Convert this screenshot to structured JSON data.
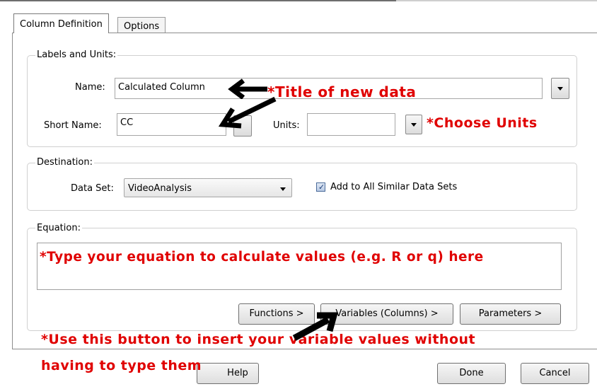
{
  "tabs": [
    {
      "label": "Column Definition",
      "active": true
    },
    {
      "label": "Options",
      "active": false
    }
  ],
  "labels_units": {
    "title": "Labels and Units:",
    "name_label": "Name:",
    "name_value": "Calculated Column",
    "short_name_label": "Short Name:",
    "short_name_value": "CC",
    "units_label": "Units:",
    "units_value": ""
  },
  "destination": {
    "title": "Destination:",
    "data_set_label": "Data Set:",
    "data_set_value": "VideoAnalysis",
    "add_all_label": "Add to All Similar Data Sets",
    "add_all_checked": true
  },
  "equation": {
    "title": "Equation:",
    "value": ""
  },
  "equation_buttons": {
    "functions": "Functions >",
    "variables": "Variables (Columns) >",
    "parameters": "Parameters >"
  },
  "footer": {
    "help": "Help",
    "done": "Done",
    "cancel": "Cancel"
  },
  "annotations": {
    "title_note": "*Title of new data",
    "units_note": "*Choose Units",
    "equation_note": "*Type your equation to calculate values (e.g. R or q) here",
    "variables_note_line1": "*Use this button to insert your variable values without",
    "variables_note_line2": "having to type them"
  },
  "colors": {
    "annotation": "#e00000",
    "arrow": "#000000"
  }
}
